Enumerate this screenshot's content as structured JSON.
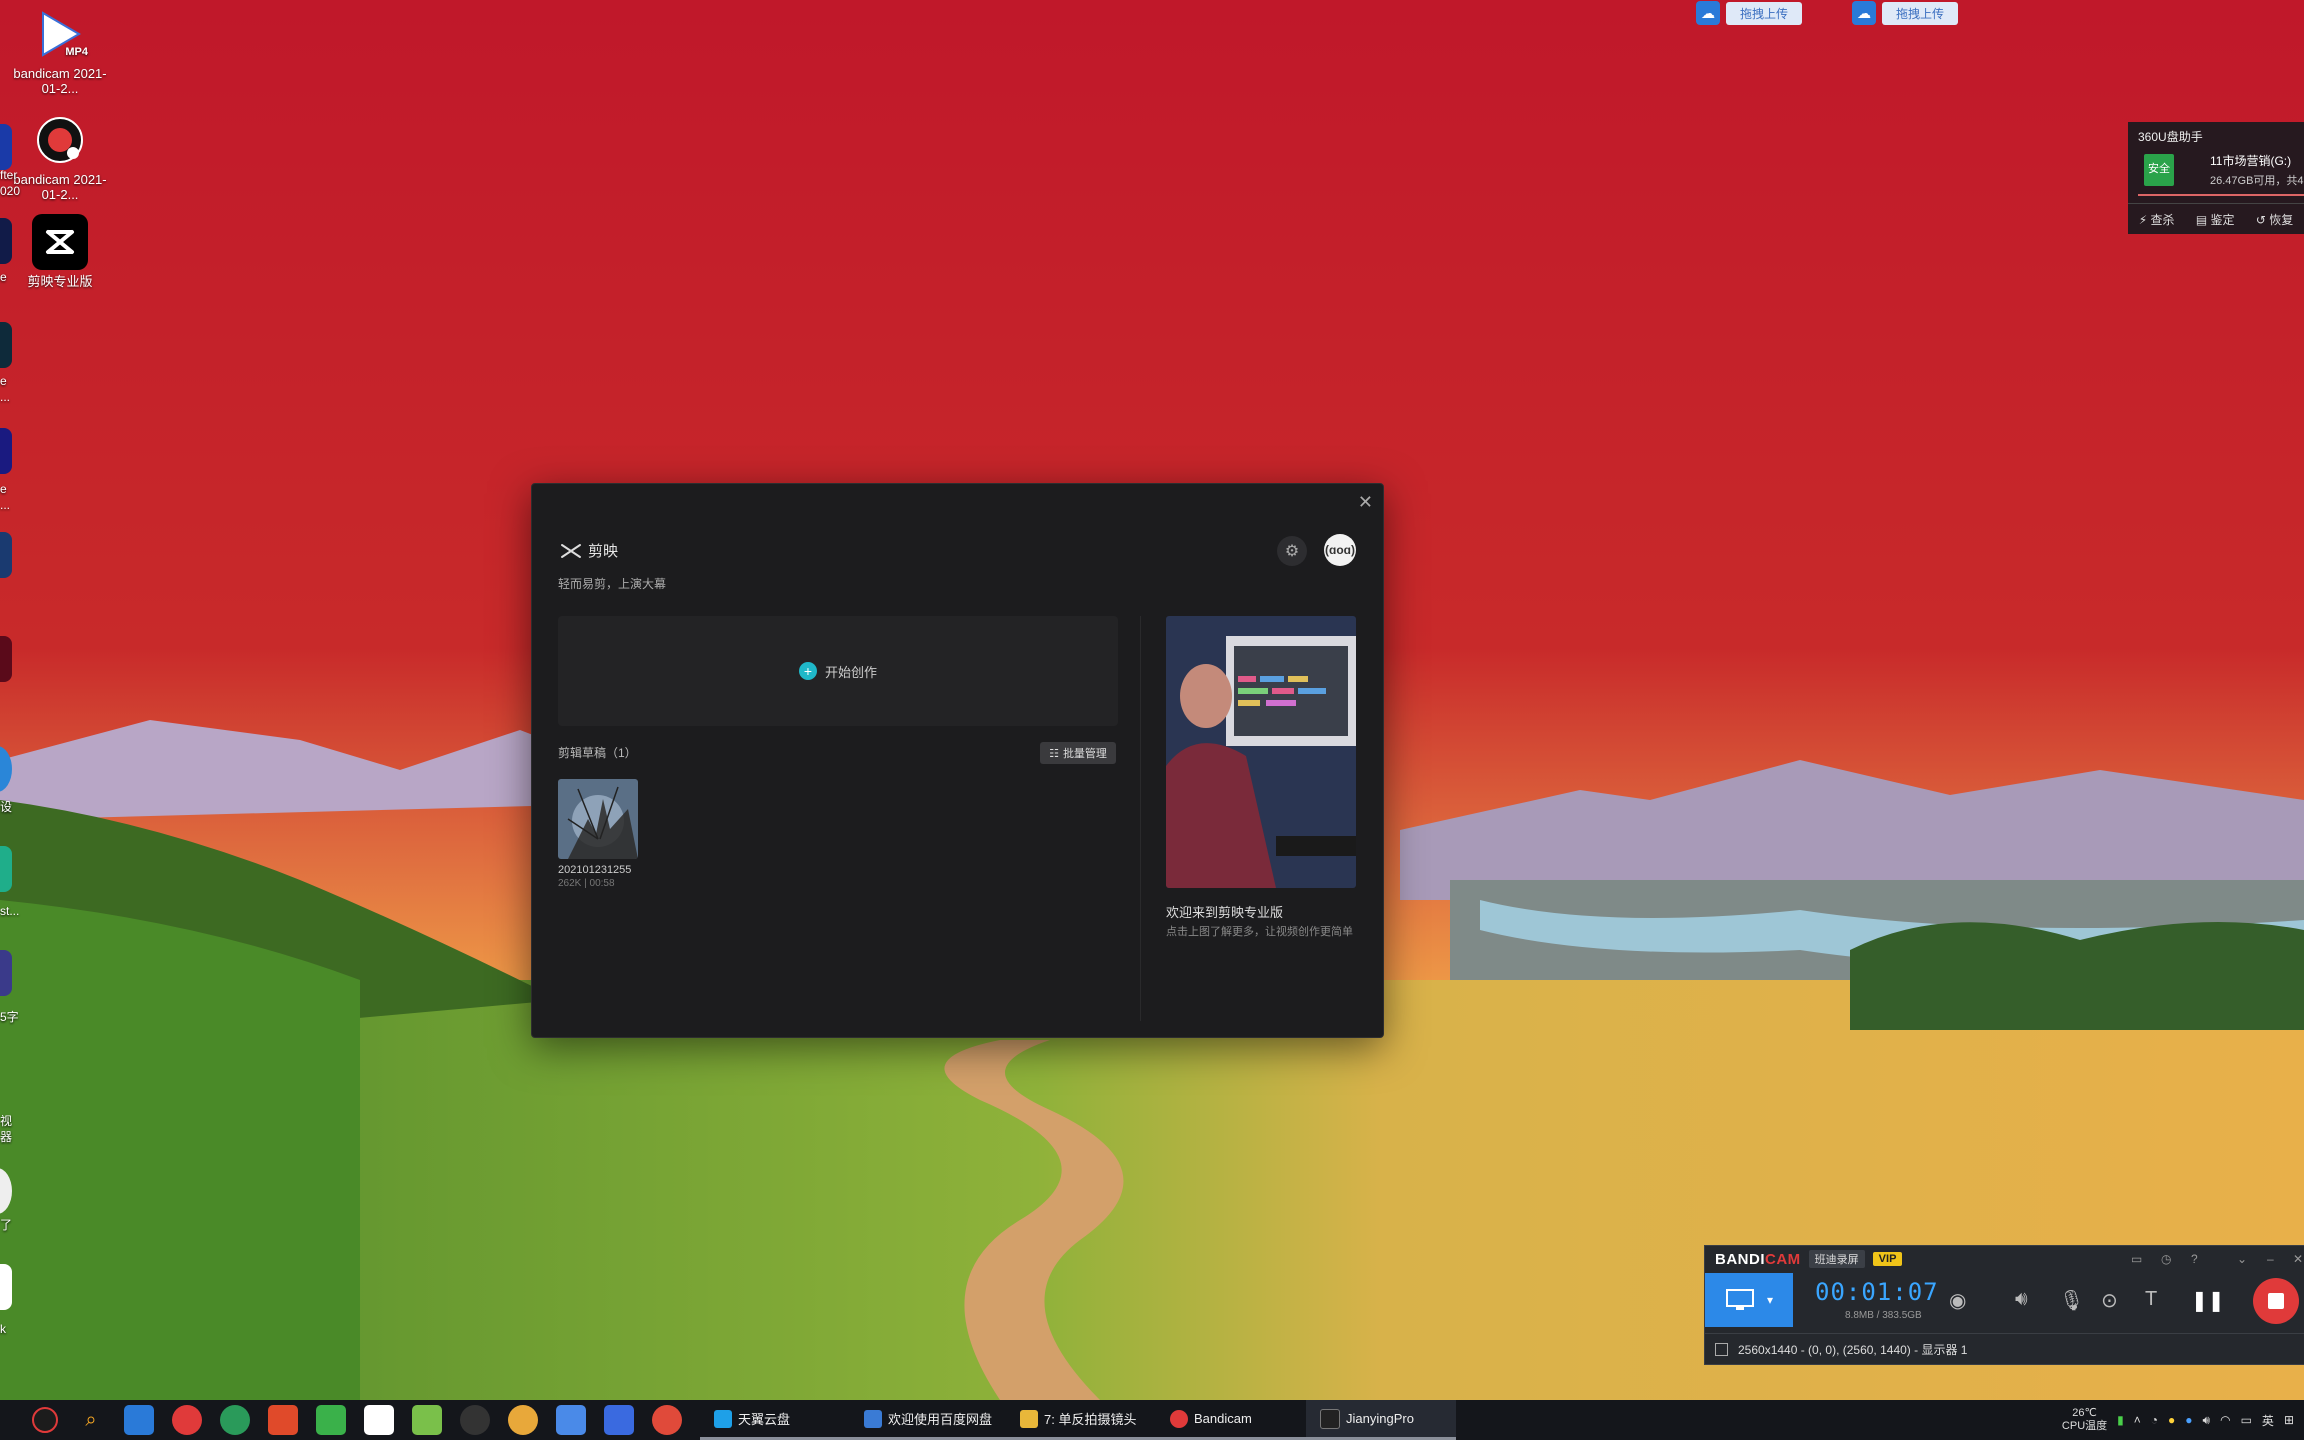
{
  "desktop": {
    "icons": [
      {
        "label": "bandicam 2021-01-2...",
        "badge": "MP4"
      },
      {
        "label": "bandicam 2021-01-2..."
      },
      {
        "label": "剪映专业版"
      }
    ],
    "partial_labels": [
      "e",
      "fter",
      "020",
      "e",
      "...",
      "e",
      "...",
      "设",
      "st...",
      "5字",
      "视",
      "器",
      "了",
      "k"
    ]
  },
  "upload_badges": [
    {
      "label": "拖拽上传"
    },
    {
      "label": "拖拽上传"
    }
  ],
  "widget360": {
    "title": "360U盘助手",
    "drive_status": "安全",
    "drive_name": "11市场营销(G:)",
    "drive_free": "26.47GB可用，共4",
    "actions": [
      "查杀",
      "鉴定",
      "恢复"
    ]
  },
  "jianying": {
    "app_name": "剪映",
    "tagline": "轻而易剪，上演大幕",
    "close_label": "✕",
    "avatar_label": "(ɑoɑ)",
    "start_label": "开始创作",
    "drafts_title": "剪辑草稿（1）",
    "batch_label": "批量管理",
    "draft": {
      "name": "202101231255",
      "meta": "262K | 00:58"
    },
    "welcome_title": "欢迎来到剪映专业版",
    "welcome_desc": "点击上图了解更多，让视频创作更简单"
  },
  "bandicam": {
    "brand_a": "BANDI",
    "brand_b": "CAM",
    "tag": "班迪录屏",
    "vip": "VIP",
    "timer": "00:01:07",
    "size": "8.8MB / 383.5GB",
    "region": "2560x1440 - (0, 0), (2560, 1440) - 显示器 1"
  },
  "taskbar": {
    "apps": [
      {
        "label": "天翼云盘",
        "color": "#1ea0e8"
      },
      {
        "label": "欢迎使用百度网盘",
        "color": "#3a7bd5"
      },
      {
        "label": "7: 单反拍摄镜头",
        "color": "#e8b73a"
      },
      {
        "label": "Bandicam",
        "color": "#e03a3a"
      },
      {
        "label": "JianyingPro",
        "color": "#222222"
      }
    ],
    "temp": "26℃",
    "temp_label": "CPU温度",
    "lang": "英"
  }
}
